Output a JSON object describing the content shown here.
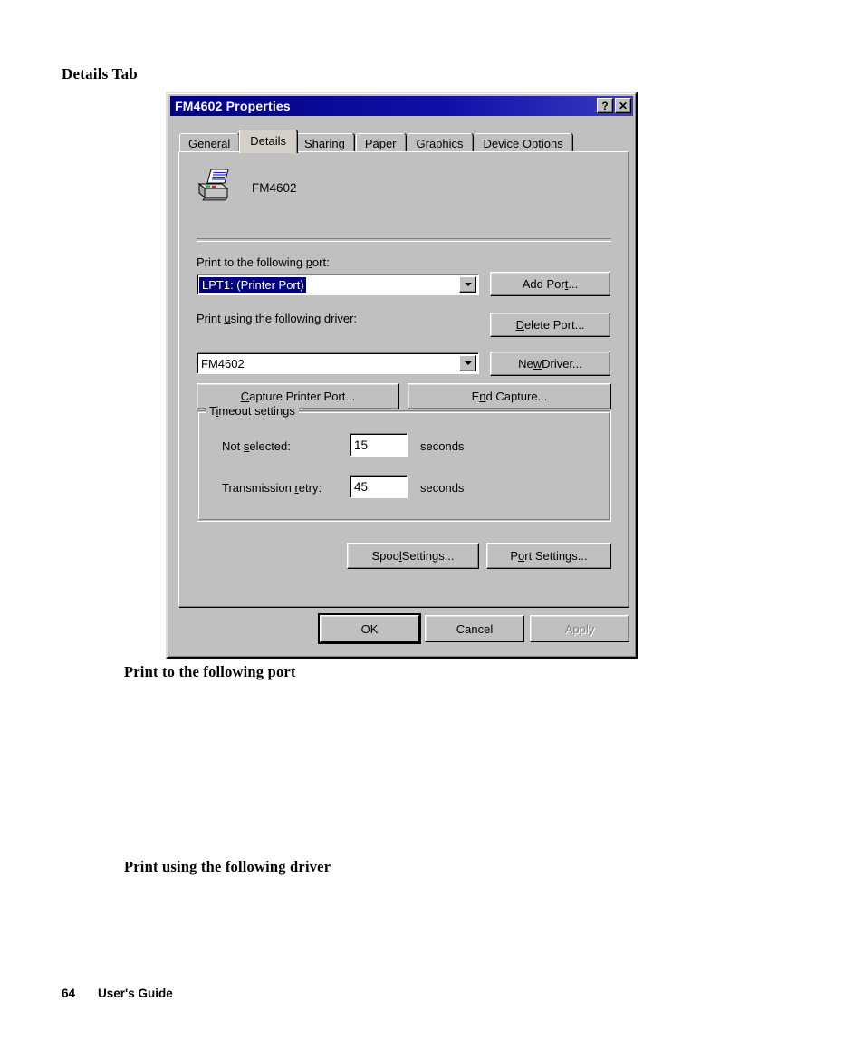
{
  "page": {
    "section_title": "Details Tab",
    "body_heading_1": "Print to the following port",
    "body_heading_2": "Print using the following driver",
    "footer_page_number": "64",
    "footer_text": "User's Guide"
  },
  "dialog": {
    "title": "FM4602 Properties",
    "help_button": "?",
    "close_button": "✕",
    "tabs": [
      {
        "label": "General",
        "selected": false
      },
      {
        "label": "Details",
        "selected": true
      },
      {
        "label": "Sharing",
        "selected": false
      },
      {
        "label": "Paper",
        "selected": false
      },
      {
        "label": "Graphics",
        "selected": false
      },
      {
        "label": "Device Options",
        "selected": false
      }
    ],
    "printer": {
      "icon": "printer-icon",
      "name": "FM4602"
    },
    "port_section": {
      "label_pre": "Print to the following ",
      "label_accel": "p",
      "label_post": "ort:",
      "selected_value": "LPT1:  (Printer Port)",
      "dropdown_icon": "chevron-down-icon"
    },
    "driver_section": {
      "label_pre": "Print ",
      "label_accel": "u",
      "label_post": "sing the following driver:",
      "selected_value": "FM4602",
      "dropdown_icon": "chevron-down-icon"
    },
    "buttons": {
      "add_port_pre": "Add Por",
      "add_port_accel": "t",
      "add_port_post": "...",
      "delete_port_accel": "D",
      "delete_port_post": "elete Port...",
      "new_driver_pre": "Ne",
      "new_driver_accel": "w",
      "new_driver_post": " Driver...",
      "capture_accel": "C",
      "capture_post": "apture Printer Port...",
      "end_capture_pre": "E",
      "end_capture_accel": "n",
      "end_capture_post": "d Capture...",
      "spool_pre": "Spoo",
      "spool_accel": "l",
      "spool_post": " Settings...",
      "port_settings_pre": "P",
      "port_settings_accel": "o",
      "port_settings_post": "rt Settings...",
      "ok": "OK",
      "cancel": "Cancel",
      "apply": "Apply",
      "apply_disabled": true
    },
    "timeout_group": {
      "title_pre": "T",
      "title_accel": "i",
      "title_post": "meout settings",
      "rows": [
        {
          "label_pre": "Not ",
          "label_accel": "s",
          "label_post": "elected:",
          "value": "15",
          "unit": "seconds"
        },
        {
          "label_pre": "Transmission ",
          "label_accel": "r",
          "label_post": "etry:",
          "value": "45",
          "unit": "seconds"
        }
      ]
    }
  },
  "colors": {
    "title_bar": "#00007f",
    "dialog_face": "#c0c0c0",
    "selection": "#000080",
    "field_bg": "#ffffff",
    "disabled_text": "#808080"
  }
}
